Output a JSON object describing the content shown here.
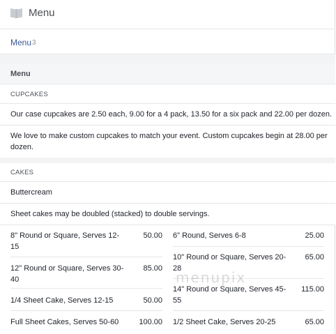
{
  "header": {
    "title": "Menu",
    "icon": "book-icon"
  },
  "menu_link": {
    "label": "Menu",
    "count": "3"
  },
  "section": {
    "title": "Menu"
  },
  "cupcakes": {
    "category": "CUPCAKES",
    "line1": "Our case cupcakes are 2.50 each, 9.00 for a 4 pack, 13.50 for a six pack and 22.00 per dozen.",
    "line2a": "We love to make custom cupcakes to match your event. Custom cupcakes begin at 28.00 per",
    "line2b": "dozen."
  },
  "cakes": {
    "category": "CAKES",
    "buttercream": "Buttercream",
    "note": "Sheet cakes may be doubled (stacked) to double servings.",
    "left": [
      {
        "name1": "8\" Round or Square, Serves 12-",
        "name2": "15",
        "price": "50.00"
      },
      {
        "name1": "12\" Round or Square, Serves 30-",
        "name2": "40",
        "price": "85.00"
      },
      {
        "name1": "1/4 Sheet Cake, Serves 12-15",
        "name2": "",
        "price": "50.00"
      },
      {
        "name1": "Full Sheet Cakes, Serves 50-60",
        "name2": "",
        "price": "100.00"
      }
    ],
    "right": [
      {
        "name1": "6\" Round, Serves 6-8",
        "name2": "",
        "price": "25.00"
      },
      {
        "name1": "10\" Round or Square, Serves 20-",
        "name2": "28",
        "price": "65.00"
      },
      {
        "name1": "14\" Round or Square, Serves 45-",
        "name2": "55",
        "price": "115.00"
      },
      {
        "name1": "1/2 Sheet Cake, Serves 20-25",
        "name2": "",
        "price": "65.00"
      }
    ]
  },
  "watermark": "menupix"
}
